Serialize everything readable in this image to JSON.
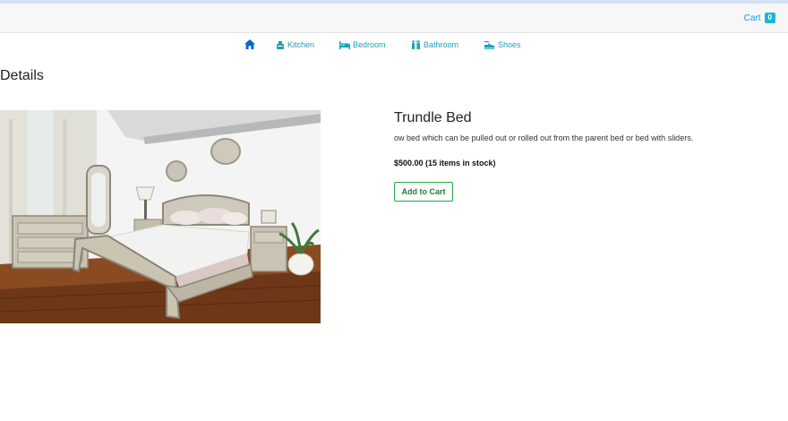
{
  "header": {
    "cart_label": "Cart",
    "cart_count": "0"
  },
  "nav": {
    "home_icon": "home-icon",
    "items": [
      {
        "label": "Kitchen",
        "icon": "kitchen-icon"
      },
      {
        "label": "Bedroom",
        "icon": "bed-icon"
      },
      {
        "label": "Bathroom",
        "icon": "bath-icon"
      },
      {
        "label": "Shoes",
        "icon": "shoe-icon"
      }
    ]
  },
  "page": {
    "heading": "Details"
  },
  "product": {
    "name": "Trundle Bed",
    "description": "ow bed which can be pulled out or rolled out from the parent bed or bed with sliders.",
    "price_stock": "$500.00 (15 items in stock)",
    "add_to_cart_label": "Add to Cart"
  },
  "colors": {
    "link": "#17a2b8",
    "cart_badge": "#19b6d8",
    "button_border": "#28a745",
    "home_icon": "#0a66c2"
  }
}
